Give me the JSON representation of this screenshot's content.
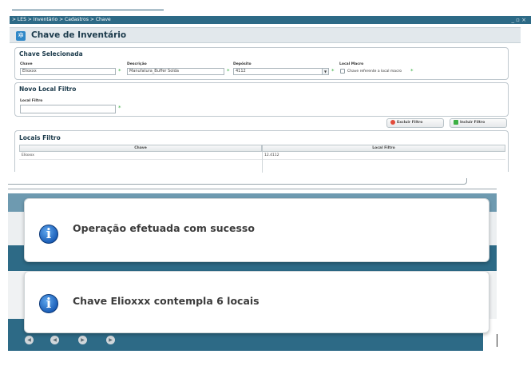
{
  "window": {
    "breadcrumb": "> LES > Inventário > Cadastros > Chave",
    "controls": "_ ▫ ×"
  },
  "page": {
    "title": "Chave de Inventário",
    "title_icon": "gear-icon"
  },
  "chave_selecionada": {
    "title": "Chave Selecionada",
    "chave_label": "Chave",
    "chave_value": "Elioxxx",
    "descricao_label": "Descrição",
    "descricao_value": "Manufatura_Buffer Solda",
    "deposito_label": "Depósito",
    "deposito_value": "4112",
    "local_macro_label": "Local Macro",
    "local_macro_checkbox_label": "Chave referente a local macro",
    "local_macro_checked": false,
    "required_mark": "*"
  },
  "novo_local": {
    "title": "Novo Local Filtro",
    "local_filtro_label": "Local Filtro",
    "local_filtro_value": ""
  },
  "buttons": {
    "excluir": "Excluir Filtro",
    "incluir": "Incluir Filtro"
  },
  "locais_filtro": {
    "title": "Locais Filtro",
    "columns": [
      "Chave",
      "Local Filtro"
    ],
    "rows": [
      {
        "chave": "Elioxxx",
        "local_filtro": "12.4112"
      }
    ]
  },
  "messages": [
    "Operação efetuada com sucesso",
    "Chave Elioxxx contempla 6 locais"
  ],
  "colors": {
    "brand": "#2d6a86",
    "info_blue": "#1c5fb8",
    "required": "#3cb043"
  }
}
